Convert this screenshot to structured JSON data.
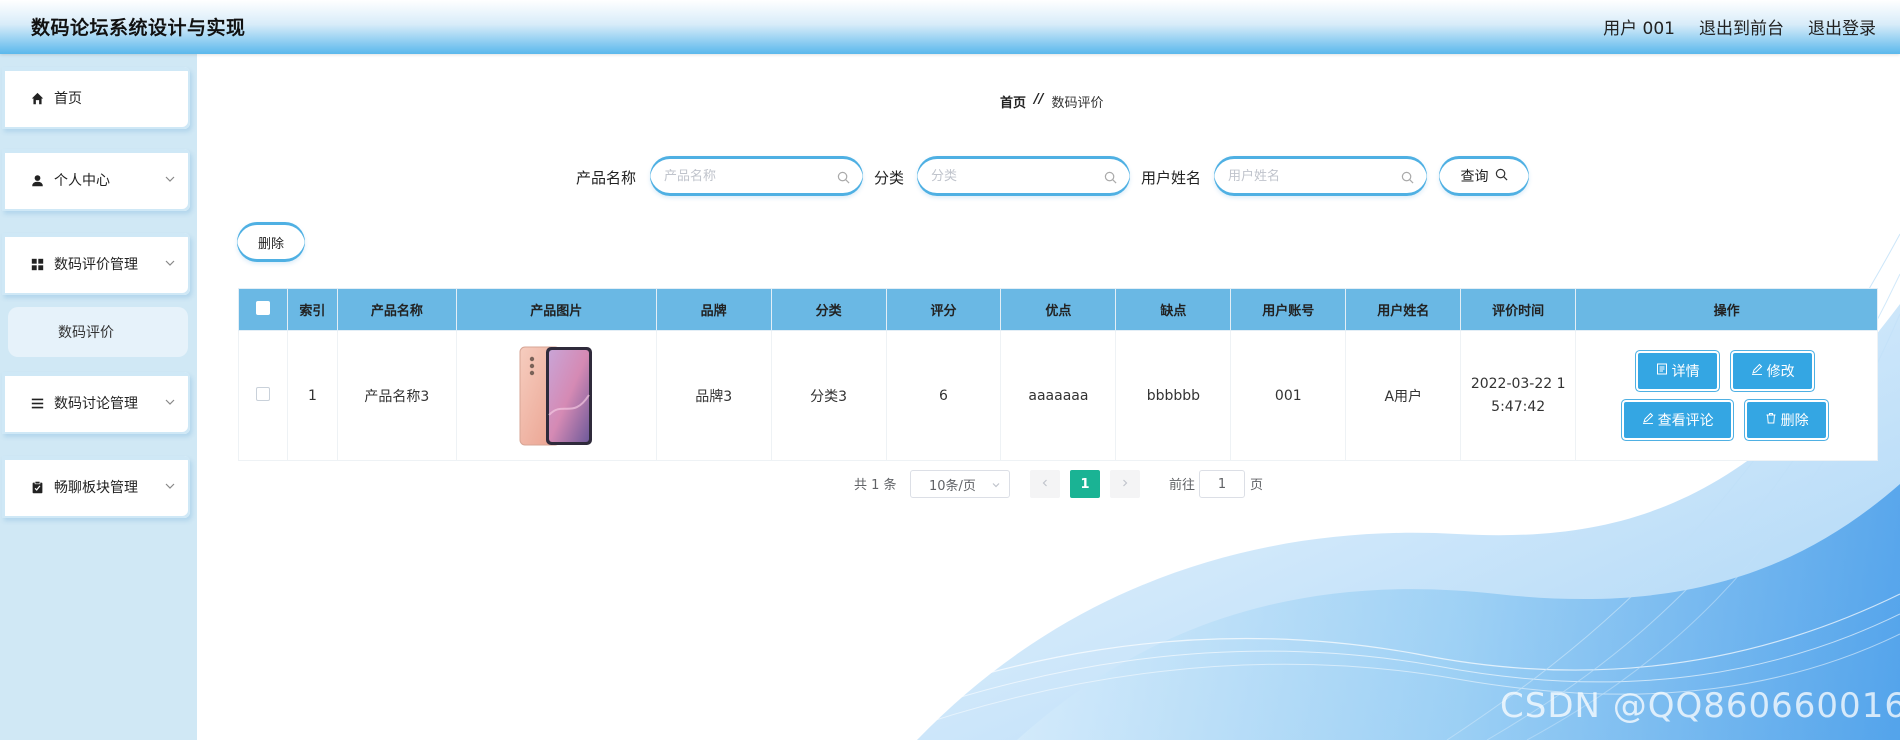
{
  "header": {
    "title": "数码论坛系统设计与实现",
    "user": "用户 001",
    "to_front": "退出到前台",
    "logout": "退出登录"
  },
  "sidebar": {
    "items": [
      {
        "label": "首页",
        "icon": "home-icon"
      },
      {
        "label": "个人中心",
        "icon": "user-icon"
      },
      {
        "label": "数码评价管理",
        "icon": "grid-icon"
      },
      {
        "label": "数码评价",
        "icon": ""
      },
      {
        "label": "数码讨论管理",
        "icon": "list-icon"
      },
      {
        "label": "畅聊板块管理",
        "icon": "clipboard-icon"
      }
    ]
  },
  "breadcrumb": {
    "home": "首页",
    "separator": "//",
    "current": "数码评价"
  },
  "search": {
    "product_label": "产品名称",
    "product_placeholder": "产品名称",
    "category_label": "分类",
    "category_placeholder": "分类",
    "username_label": "用户姓名",
    "username_placeholder": "用户姓名",
    "query_label": "查询"
  },
  "toolbar": {
    "delete_label": "删除"
  },
  "table": {
    "headers": [
      "索引",
      "产品名称",
      "产品图片",
      "品牌",
      "分类",
      "评分",
      "优点",
      "缺点",
      "用户账号",
      "用户姓名",
      "评价时间",
      "操作"
    ],
    "rows": [
      {
        "index": "1",
        "product": "产品名称3",
        "brand": "品牌3",
        "category": "分类3",
        "score": "6",
        "pros": "aaaaaaa",
        "cons": "bbbbbb",
        "account": "001",
        "username": "A用户",
        "time_line1": "2022-03-22 1",
        "time_line2": "5:47:42",
        "actions": {
          "detail": "详情",
          "edit": "修改",
          "comments": "查看评论",
          "delete": "删除"
        }
      }
    ]
  },
  "pagination": {
    "total": "共 1 条",
    "page_size": "10条/页",
    "current_page": "1",
    "goto_label": "前往",
    "goto_value": "1",
    "page_suffix": "页"
  },
  "watermark": "CSDN @QQ860660016",
  "colors": {
    "accent": "#34a6e3",
    "table_header": "#6ab8e4",
    "sidebar_bg": "#d0e8f5",
    "page_active": "#1ab394"
  }
}
